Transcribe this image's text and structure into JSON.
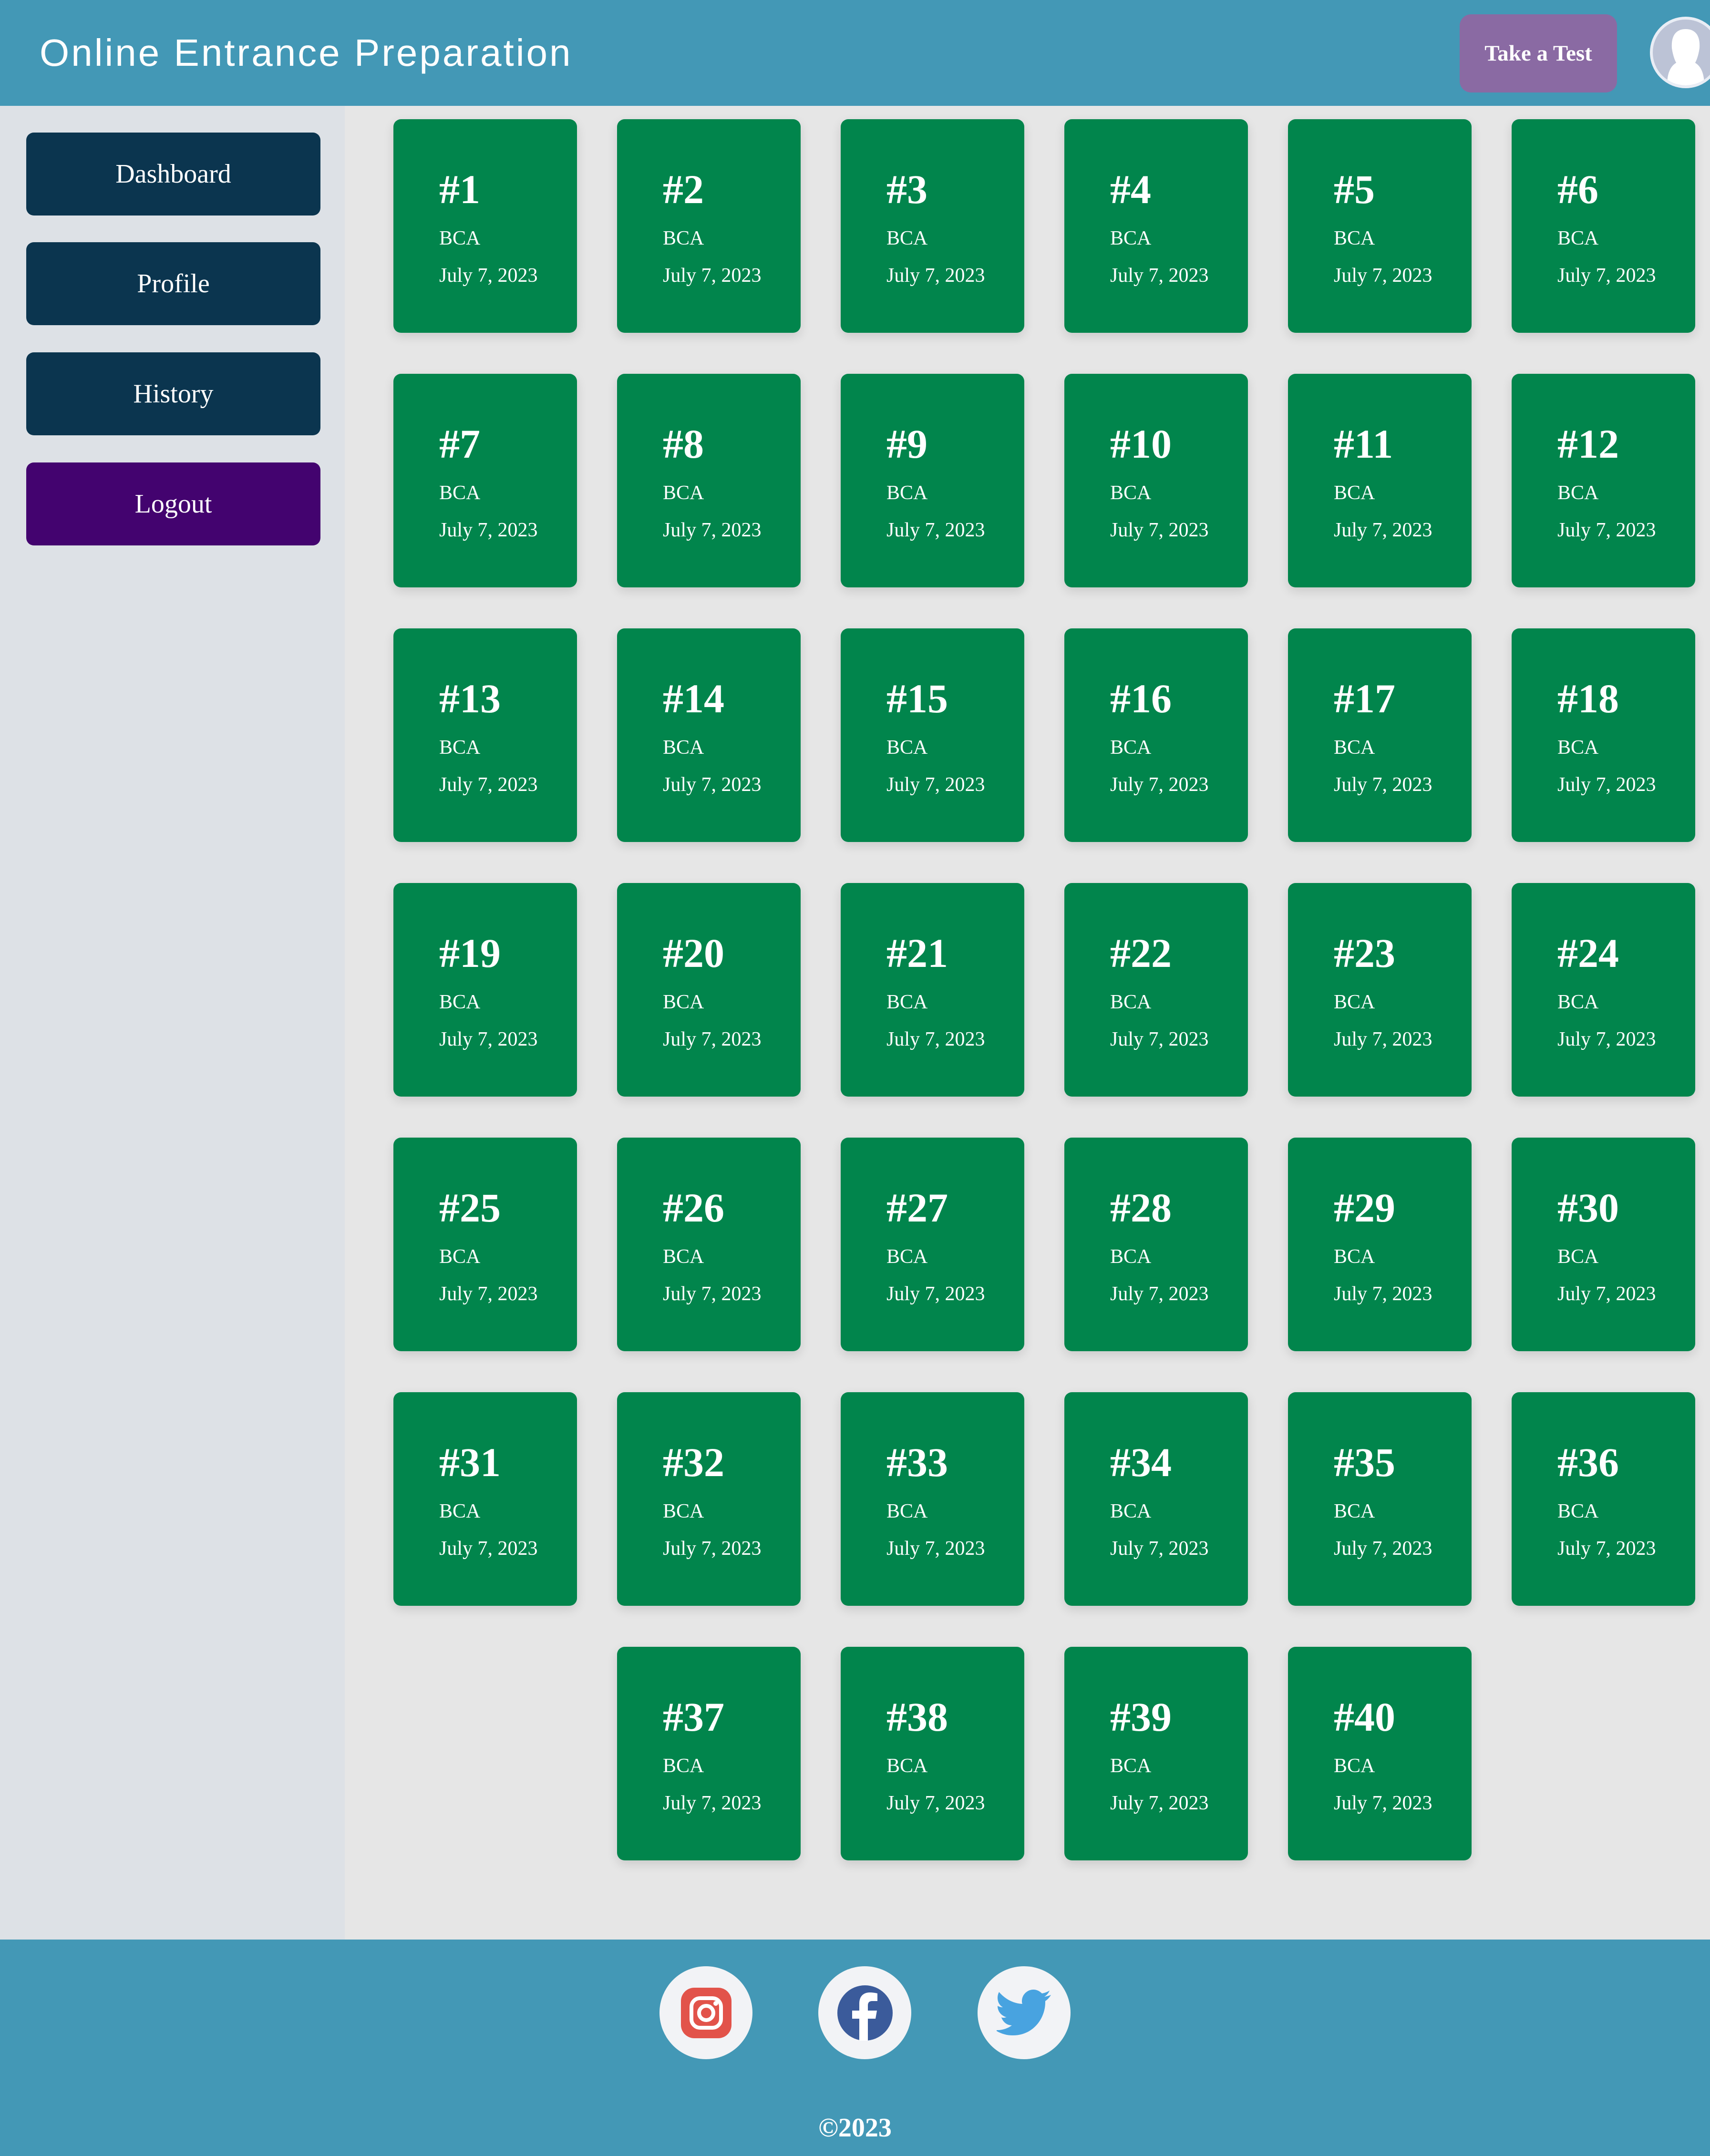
{
  "header": {
    "app_title": "Online Entrance Preparation",
    "take_test_label": "Take a Test",
    "avatar_icon": "user-avatar-icon"
  },
  "sidebar": {
    "items": [
      {
        "label": "Dashboard",
        "name": "sidebar-dashboard-button"
      },
      {
        "label": "Profile",
        "name": "sidebar-profile-button"
      },
      {
        "label": "History",
        "name": "sidebar-history-button"
      },
      {
        "label": "Logout",
        "name": "sidebar-logout-button"
      }
    ]
  },
  "tests": [
    {
      "number": "#1",
      "course": "BCA",
      "date": "July 7, 2023"
    },
    {
      "number": "#2",
      "course": "BCA",
      "date": "July 7, 2023"
    },
    {
      "number": "#3",
      "course": "BCA",
      "date": "July 7, 2023"
    },
    {
      "number": "#4",
      "course": "BCA",
      "date": "July 7, 2023"
    },
    {
      "number": "#5",
      "course": "BCA",
      "date": "July 7, 2023"
    },
    {
      "number": "#6",
      "course": "BCA",
      "date": "July 7, 2023"
    },
    {
      "number": "#7",
      "course": "BCA",
      "date": "July 7, 2023"
    },
    {
      "number": "#8",
      "course": "BCA",
      "date": "July 7, 2023"
    },
    {
      "number": "#9",
      "course": "BCA",
      "date": "July 7, 2023"
    },
    {
      "number": "#10",
      "course": "BCA",
      "date": "July 7, 2023"
    },
    {
      "number": "#11",
      "course": "BCA",
      "date": "July 7, 2023"
    },
    {
      "number": "#12",
      "course": "BCA",
      "date": "July 7, 2023"
    },
    {
      "number": "#13",
      "course": "BCA",
      "date": "July 7, 2023"
    },
    {
      "number": "#14",
      "course": "BCA",
      "date": "July 7, 2023"
    },
    {
      "number": "#15",
      "course": "BCA",
      "date": "July 7, 2023"
    },
    {
      "number": "#16",
      "course": "BCA",
      "date": "July 7, 2023"
    },
    {
      "number": "#17",
      "course": "BCA",
      "date": "July 7, 2023"
    },
    {
      "number": "#18",
      "course": "BCA",
      "date": "July 7, 2023"
    },
    {
      "number": "#19",
      "course": "BCA",
      "date": "July 7, 2023"
    },
    {
      "number": "#20",
      "course": "BCA",
      "date": "July 7, 2023"
    },
    {
      "number": "#21",
      "course": "BCA",
      "date": "July 7, 2023"
    },
    {
      "number": "#22",
      "course": "BCA",
      "date": "July 7, 2023"
    },
    {
      "number": "#23",
      "course": "BCA",
      "date": "July 7, 2023"
    },
    {
      "number": "#24",
      "course": "BCA",
      "date": "July 7, 2023"
    },
    {
      "number": "#25",
      "course": "BCA",
      "date": "July 7, 2023"
    },
    {
      "number": "#26",
      "course": "BCA",
      "date": "July 7, 2023"
    },
    {
      "number": "#27",
      "course": "BCA",
      "date": "July 7, 2023"
    },
    {
      "number": "#28",
      "course": "BCA",
      "date": "July 7, 2023"
    },
    {
      "number": "#29",
      "course": "BCA",
      "date": "July 7, 2023"
    },
    {
      "number": "#30",
      "course": "BCA",
      "date": "July 7, 2023"
    },
    {
      "number": "#31",
      "course": "BCA",
      "date": "July 7, 2023"
    },
    {
      "number": "#32",
      "course": "BCA",
      "date": "July 7, 2023"
    },
    {
      "number": "#33",
      "course": "BCA",
      "date": "July 7, 2023"
    },
    {
      "number": "#34",
      "course": "BCA",
      "date": "July 7, 2023"
    },
    {
      "number": "#35",
      "course": "BCA",
      "date": "July 7, 2023"
    },
    {
      "number": "#36",
      "course": "BCA",
      "date": "July 7, 2023"
    },
    {
      "number": "#37",
      "course": "BCA",
      "date": "July 7, 2023"
    },
    {
      "number": "#38",
      "course": "BCA",
      "date": "July 7, 2023"
    },
    {
      "number": "#39",
      "course": "BCA",
      "date": "July 7, 2023"
    },
    {
      "number": "#40",
      "course": "BCA",
      "date": "July 7, 2023"
    }
  ],
  "footer": {
    "social": [
      {
        "icon": "instagram-icon",
        "color": "#e2534a"
      },
      {
        "icon": "facebook-icon",
        "color": "#3b5b9b"
      },
      {
        "icon": "twitter-icon",
        "color": "#48a3e0"
      }
    ],
    "copyright": "©2023"
  },
  "colors": {
    "header": "#4398b6",
    "card": "#01854c",
    "nav_button": "#0b354f",
    "logout_button": "#43036f",
    "take_test_button": "#8a6aa3",
    "sidebar": "#dde1e6",
    "content": "#e6e6e6"
  }
}
